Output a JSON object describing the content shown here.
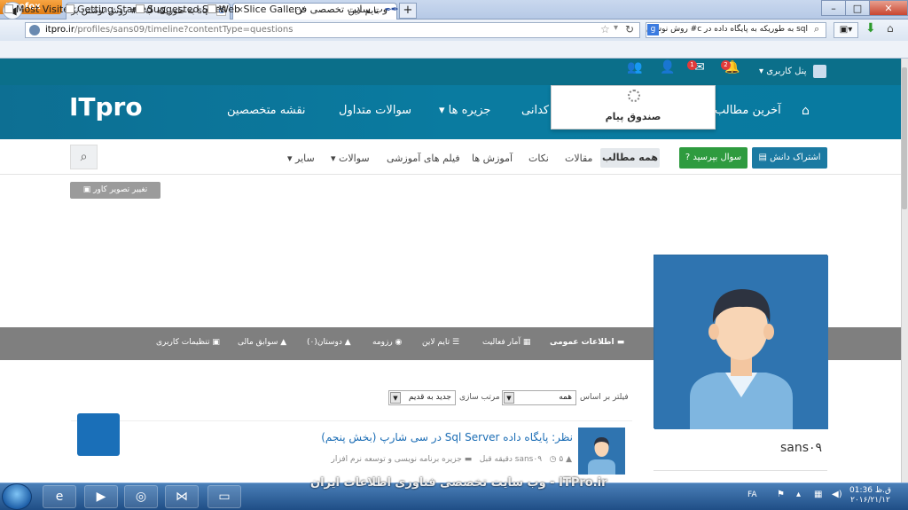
{
  "browser": {
    "menu_button": "Firefox",
    "tabs": [
      {
        "title": "sql به طوریکه ب c# روش نوشتن برنامه در"
      },
      {
        "title": "تایم لاین"
      }
    ],
    "new_tab": "+",
    "window_controls": {
      "minimize": "–",
      "maximize": "□",
      "close": "✕"
    },
    "url": {
      "host": "itpro.ir",
      "path": "/profiles/sans09/timeline?contentType=questions"
    },
    "search_text": "sql به طوریکه به پایگاه داده در c# روش نوشتن",
    "search_engine_letter": "g",
    "bookmarks": [
      "Most Visited",
      "Getting Started",
      "Suggested Sites",
      "Web Slice Gallery",
      "وب سایت تخصصی فن..."
    ]
  },
  "site": {
    "logo": "ITpro",
    "main_nav": [
      "آخرین مطالب",
      "کدانی",
      "جزیره ها",
      "سوالات متداول",
      "نقشه متخصصین"
    ],
    "home_icon": "home-icon",
    "popup_title": "صندوق پیام",
    "badges": {
      "messages": "1",
      "notifications": "2"
    },
    "user_panel": "پنل کاربری",
    "subnav": [
      "همه مطالب",
      "مقالات",
      "نکات",
      "آموزش ها",
      "فیلم های آموزشی",
      "سوالات",
      "سایر"
    ],
    "share_button": "اشتراک دانش",
    "ask_button": "سوال بپرسید",
    "cover_button": "تغییر تصویر کاور",
    "profile_tabs": [
      "اطلاعات عمومی",
      "آمار فعالیت",
      "تایم لاین",
      "رزومه",
      "دوستان(۰)",
      "سوابق مالی",
      "تنظیمات کاربری"
    ],
    "filter": {
      "filter_label": "فیلتر بر اساس",
      "filter_value": "همه",
      "sort_label": "مرتب سازی",
      "sort_value": "جدید به قدیم"
    },
    "post": {
      "title": "نظر: پایگاه داده Sql Server در سی شارپ (بخش پنجم)",
      "author": "sans۰۹",
      "time": "۵ دقیقه قبل",
      "category": "جزیره برنامه نویسی و توسعه نرم افزار"
    },
    "username": "sans۰۹"
  },
  "taskbar": {
    "watermark": "ITPro.ir - وب سایت تخصصی فناوری اطلاعات ایران",
    "language": "FA",
    "time": "01:36 ق.ظ",
    "date": "۲۰۱۶/۲۱/۱۲"
  }
}
